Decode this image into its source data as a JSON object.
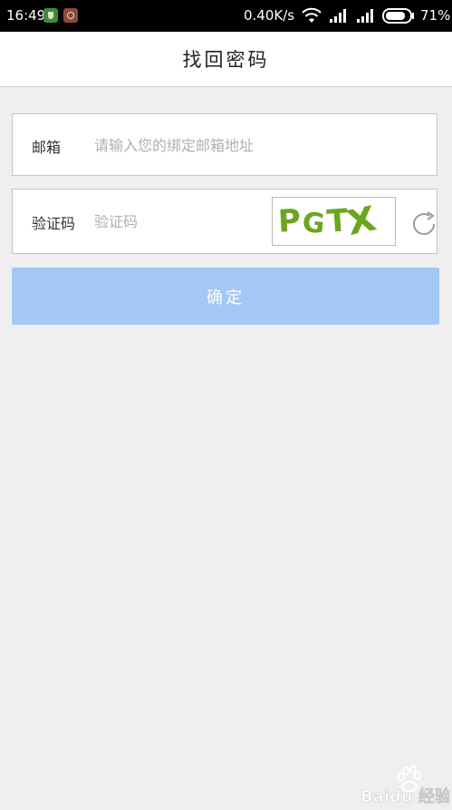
{
  "status_bar": {
    "time": "16:49",
    "network_speed": "0.40K/s",
    "battery": "71%",
    "icons": [
      "shield-notification-icon",
      "app-notification-icon",
      "wifi-icon",
      "signal-icon",
      "signal-icon",
      "battery-icon"
    ]
  },
  "header": {
    "title": "找回密码"
  },
  "form": {
    "email_label": "邮箱",
    "email_placeholder": "请输入您的绑定邮箱地址",
    "code_label": "验证码",
    "code_placeholder": "验证码",
    "captcha_chars": [
      "P",
      "G",
      "T",
      "X"
    ],
    "submit_label": "确定"
  },
  "watermark": {
    "text": "Baidu 经验"
  },
  "colors": {
    "accent_button": "#a4c8f4",
    "captcha": "#6aa61e",
    "background": "#efefef"
  }
}
